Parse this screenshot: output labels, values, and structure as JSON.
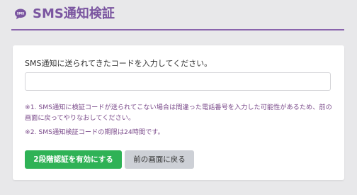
{
  "header": {
    "icon_name": "sms-bubble-icon",
    "icon_text": "SMS",
    "title": "SMS通知検証",
    "accent_color": "#7a55a0"
  },
  "form": {
    "prompt": "SMS通知に送られてきたコードを入力してください。",
    "code_value": "",
    "code_placeholder": ""
  },
  "notes": [
    "※1. SMS通知に検証コードが送られてこない場合は間違った電話番号を入力した可能性があるため、前の画面に戻ってやりなおしてください。",
    "※2. SMS通知検証コードの期限は24時間です。"
  ],
  "buttons": {
    "enable_2fa": "2段階認証を有効にする",
    "back": "前の画面に戻る"
  },
  "colors": {
    "primary_button": "#2fb256",
    "secondary_button": "#cdd0d6",
    "note_text": "#7a4a8a"
  }
}
